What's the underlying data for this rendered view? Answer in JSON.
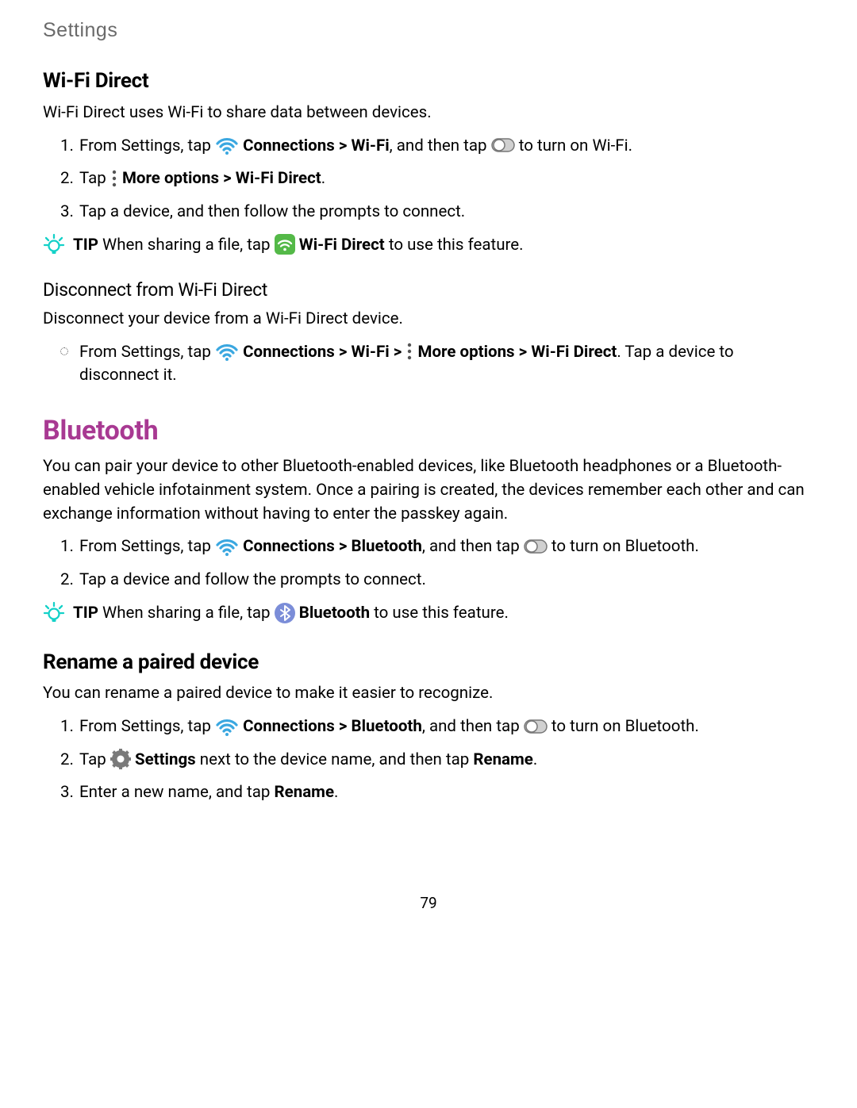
{
  "header": "Settings",
  "page_number": "79",
  "wifi_direct": {
    "title": "Wi-Fi Direct",
    "intro": "Wi-Fi Direct uses Wi-Fi to share data between devices.",
    "step1_a": "From Settings, tap ",
    "step1_b": " Connections > Wi-Fi",
    "step1_c": ", and then tap ",
    "step1_d": " to turn on Wi-Fi.",
    "step2_a": "Tap ",
    "step2_b": " More options > Wi-Fi Direct",
    "step2_c": ".",
    "step3": "Tap a device, and then follow the prompts to connect.",
    "tip_a": "TIP",
    "tip_b": "  When sharing a file, tap ",
    "tip_c": " Wi-Fi Direct",
    "tip_d": " to use this feature."
  },
  "disconnect": {
    "title": "Disconnect from Wi-Fi Direct",
    "intro": "Disconnect your device from a Wi-Fi Direct device.",
    "step_a": "From Settings, tap ",
    "step_b": " Connections > Wi-Fi > ",
    "step_c": " More options > Wi-Fi Direct",
    "step_d": ". Tap a device to disconnect it."
  },
  "bluetooth": {
    "title": "Bluetooth",
    "intro": "You can pair your device to other Bluetooth-enabled devices, like Bluetooth headphones or a Bluetooth-enabled vehicle infotainment system. Once a pairing is created, the devices remember each other and can exchange information without having to enter the passkey again.",
    "step1_a": "From Settings, tap ",
    "step1_b": " Connections > Bluetooth",
    "step1_c": ", and then tap ",
    "step1_d": " to turn on Bluetooth.",
    "step2": "Tap a device and follow the prompts to connect.",
    "tip_a": "TIP",
    "tip_b": "  When sharing a file, tap ",
    "tip_c": " Bluetooth",
    "tip_d": " to use this feature."
  },
  "rename": {
    "title": "Rename a paired device",
    "intro": "You can rename a paired device to make it easier to recognize.",
    "step1_a": "From Settings, tap ",
    "step1_b": " Connections > Bluetooth",
    "step1_c": ", and then tap ",
    "step1_d": " to turn on Bluetooth.",
    "step2_a": "Tap ",
    "step2_b": " Settings",
    "step2_c": " next to the device name, and then tap ",
    "step2_d": "Rename",
    "step2_e": ".",
    "step3_a": "Enter a new name, and tap ",
    "step3_b": "Rename",
    "step3_c": "."
  }
}
